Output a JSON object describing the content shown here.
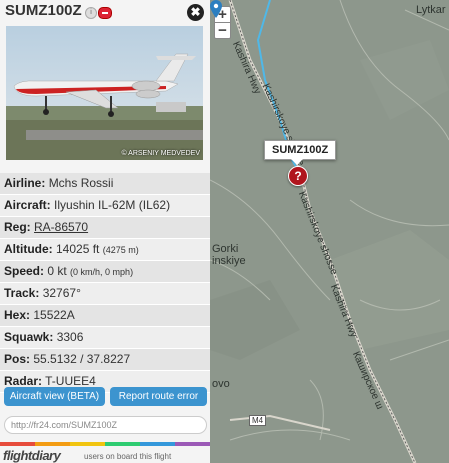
{
  "flight": {
    "callsign": "SUMZ100Z",
    "info_glyph": "i",
    "close_glyph": "✖",
    "photo_credit": "© ARSENIY MEDVEDEV"
  },
  "details": [
    {
      "label": "Airline:",
      "value": "Mchs Rossii"
    },
    {
      "label": "Aircraft:",
      "value": "Ilyushin IL-62M (IL62)"
    },
    {
      "label": "Reg:",
      "value": "RA-86570"
    },
    {
      "label": "Altitude:",
      "value": "14025 ft",
      "extra": "(4275 m)"
    },
    {
      "label": "Speed:",
      "value": "0 kt",
      "extra": "(0 km/h, 0 mph)"
    },
    {
      "label": "Track:",
      "value": "32767°"
    },
    {
      "label": "Hex:",
      "value": "15522A"
    },
    {
      "label": "Squawk:",
      "value": "3306"
    },
    {
      "label": "Pos:",
      "value": "55.5132 / 37.8227"
    },
    {
      "label": "Radar:",
      "value": "T-UUEE4"
    }
  ],
  "buttons": {
    "aircraft_view": "Aircraft view (BETA)",
    "report_route": "Report route error"
  },
  "url_field": {
    "value": "http://fr24.com/SUMZ100Z"
  },
  "flightdiary": {
    "logo": "flightdiary",
    "text": "users on board this flight"
  },
  "map": {
    "zoom_in": "+",
    "zoom_out": "−",
    "marker_glyph": "?",
    "bubble": "SUMZ100Z",
    "places": {
      "lytkar": "Lytkar",
      "gorki": "Gorki",
      "inskiye": "inskiye",
      "vo": "ovo"
    },
    "roads": {
      "kashira_hwy_top": "Kashira Hwy",
      "kashirskoye_top": "Kashirskoye shosse",
      "kashirskoye_mid": "Kashirskoye shosse",
      "kashira_hwy_mid": "Kashira Hwy",
      "kashirskoe_cyr": "Каширское ш",
      "m4": "M4"
    }
  },
  "colors": {
    "map_bg": "#8d978c",
    "flight_path": "#4fb8e8",
    "marker": "#b0151d",
    "button": "#3c94cf"
  }
}
